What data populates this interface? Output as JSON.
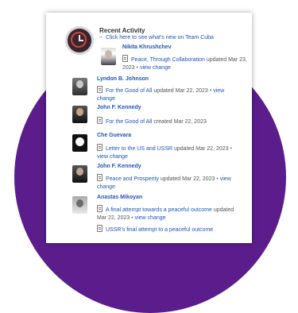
{
  "header": {
    "title": "Recent Activity",
    "link_label": "Click here to see what's new on Team Cuba"
  },
  "entries": [
    {
      "name": "Nikita Khrushchev",
      "doc_title": "Peace, Through Collaboration",
      "action": "updated Mar 23, 2023",
      "bullet": "•",
      "view_label": "view change"
    },
    {
      "name": "Lyndon B. Johnson",
      "doc_title": "For the Good of All",
      "action": "updated Mar 22, 2023",
      "bullet": "•",
      "view_label": "view change"
    },
    {
      "name": "John F. Kennedy",
      "doc_title": "For the Good of All",
      "action": "created Mar 22, 2023"
    },
    {
      "name": "Che Guevara",
      "doc_title": "Letter to the US and USSR",
      "action": "updated Mar 22, 2023",
      "bullet": "•",
      "view_label": "view change"
    },
    {
      "name": "John F. Kennedy",
      "doc_title": "Peace and Prosperity",
      "action": "updated Mar 22, 2023",
      "bullet": "•",
      "view_label": "view change"
    },
    {
      "name": "Anastas Mikoyan",
      "doc_title": "A final attempt towards a peaceful outcome",
      "action": "updated Mar 22, 2023",
      "bullet": "•",
      "view_label": "view change",
      "doc2_title": "USSR's final attempt to a peaceful outcome"
    }
  ]
}
